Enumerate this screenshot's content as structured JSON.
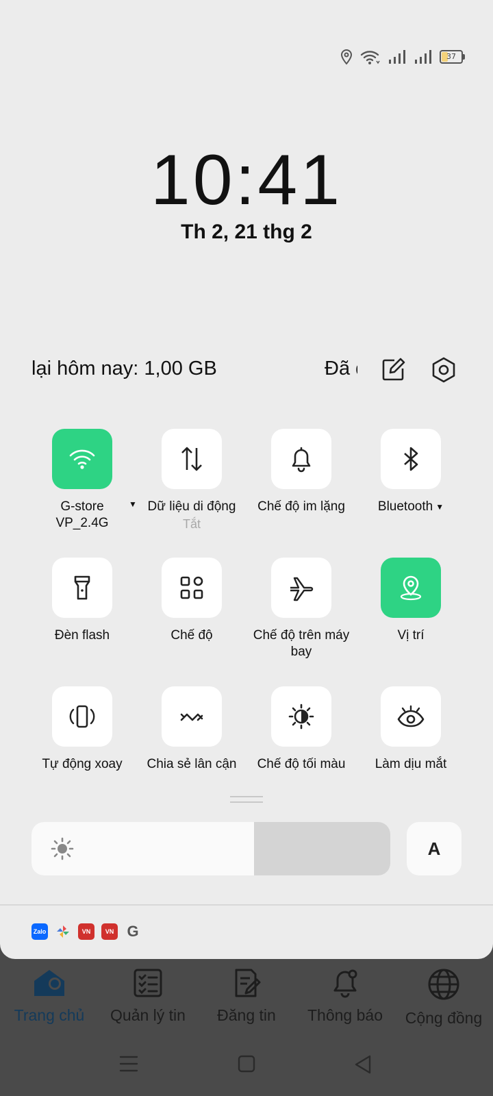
{
  "status_bar": {
    "battery_level": "37"
  },
  "clock": {
    "time": "10:41",
    "date": "Th 2, 21 thg 2"
  },
  "data_usage": {
    "primary": "lại hôm nay: 1,00 GB",
    "secondary": "Đã d"
  },
  "tiles": [
    {
      "name": "wifi",
      "label": "G-store VP_2.4G",
      "sub": "",
      "active": true
    },
    {
      "name": "mobile-data",
      "label": "Dữ liệu di động",
      "sub": "Tắt",
      "active": false
    },
    {
      "name": "silent-mode",
      "label": "Chế độ im lặng",
      "sub": "",
      "active": false
    },
    {
      "name": "bluetooth",
      "label": "Bluetooth",
      "sub": "",
      "active": false
    },
    {
      "name": "flashlight",
      "label": "Đèn flash",
      "sub": "",
      "active": false
    },
    {
      "name": "modes",
      "label": "Chế độ",
      "sub": "",
      "active": false
    },
    {
      "name": "airplane-mode",
      "label": "Chế độ trên máy bay",
      "sub": "",
      "active": false
    },
    {
      "name": "location",
      "label": "Vị trí",
      "sub": "",
      "active": true
    },
    {
      "name": "auto-rotate",
      "label": "Tự động xoay",
      "sub": "",
      "active": false
    },
    {
      "name": "nearby-share",
      "label": "Chia sẻ lân cận",
      "sub": "",
      "active": false
    },
    {
      "name": "dark-mode",
      "label": "Chế độ tối màu",
      "sub": "",
      "active": false
    },
    {
      "name": "eye-comfort",
      "label": "Làm dịu mắt",
      "sub": "",
      "active": false
    }
  ],
  "brightness": {
    "level": 0.62,
    "auto_label": "A"
  },
  "notification_icons": [
    {
      "name": "zalo",
      "text": "Zalo",
      "color": "#0a68ff"
    },
    {
      "name": "pinwheel",
      "text": "",
      "color": "#ffffff"
    },
    {
      "name": "vn-app-1",
      "text": "VN",
      "color": "#d0312d"
    },
    {
      "name": "vn-app-2",
      "text": "VN",
      "color": "#d0312d"
    },
    {
      "name": "google",
      "text": "G",
      "color": "#ececec"
    }
  ],
  "app_nav": [
    {
      "name": "home",
      "label": "Trang chủ",
      "active": true
    },
    {
      "name": "manage-posts",
      "label": "Quản lý tin",
      "active": false
    },
    {
      "name": "post-ad",
      "label": "Đăng tin",
      "active": false
    },
    {
      "name": "notifications",
      "label": "Thông báo",
      "active": false
    },
    {
      "name": "community",
      "label": "Cộng đồng",
      "active": false
    }
  ],
  "colors": {
    "accent_green": "#2ed384",
    "shade_bg": "#ececec",
    "overlay_bg": "#4a4a4a"
  }
}
